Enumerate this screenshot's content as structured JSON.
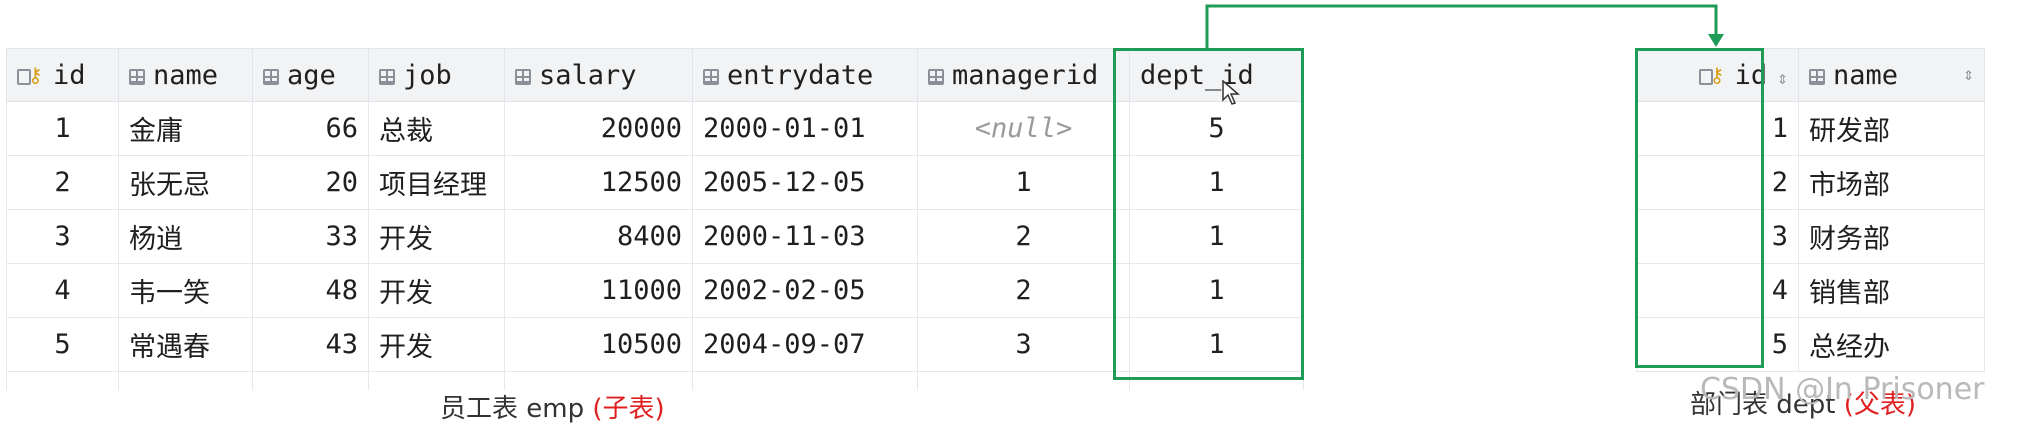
{
  "emp": {
    "columns": [
      "id",
      "name",
      "age",
      "job",
      "salary",
      "entrydate",
      "managerid",
      "dept_id"
    ],
    "rows": [
      {
        "id": "1",
        "name": "金庸",
        "age": "66",
        "job": "总裁",
        "salary": "20000",
        "entrydate": "2000-01-01",
        "managerid": "<null>",
        "dept_id": "5"
      },
      {
        "id": "2",
        "name": "张无忌",
        "age": "20",
        "job": "项目经理",
        "salary": "12500",
        "entrydate": "2005-12-05",
        "managerid": "1",
        "dept_id": "1"
      },
      {
        "id": "3",
        "name": "杨逍",
        "age": "33",
        "job": "开发",
        "salary": "8400",
        "entrydate": "2000-11-03",
        "managerid": "2",
        "dept_id": "1"
      },
      {
        "id": "4",
        "name": "韦一笑",
        "age": "48",
        "job": "开发",
        "salary": "11000",
        "entrydate": "2002-02-05",
        "managerid": "2",
        "dept_id": "1"
      },
      {
        "id": "5",
        "name": "常遇春",
        "age": "43",
        "job": "开发",
        "salary": "10500",
        "entrydate": "2004-09-07",
        "managerid": "3",
        "dept_id": "1"
      }
    ],
    "caption": "员工表 emp",
    "caption_tag": "(子表)"
  },
  "dept": {
    "columns": [
      "id",
      "name"
    ],
    "rows": [
      {
        "id": "1",
        "name": "研发部"
      },
      {
        "id": "2",
        "name": "市场部"
      },
      {
        "id": "3",
        "name": "财务部"
      },
      {
        "id": "4",
        "name": "销售部"
      },
      {
        "id": "5",
        "name": "总经办"
      }
    ],
    "caption": "部门表 dept",
    "caption_tag": "(父表)"
  },
  "watermark": "CSDN @In Prisoner",
  "colors": {
    "highlight": "#1e9c57",
    "tag": "#e02020",
    "header_bg": "#f2f3f5"
  },
  "icons": {
    "pk": "primary-key-column-icon",
    "col": "column-icon",
    "sort": "sort-arrows-icon",
    "cursor": "mouse-cursor-icon"
  }
}
